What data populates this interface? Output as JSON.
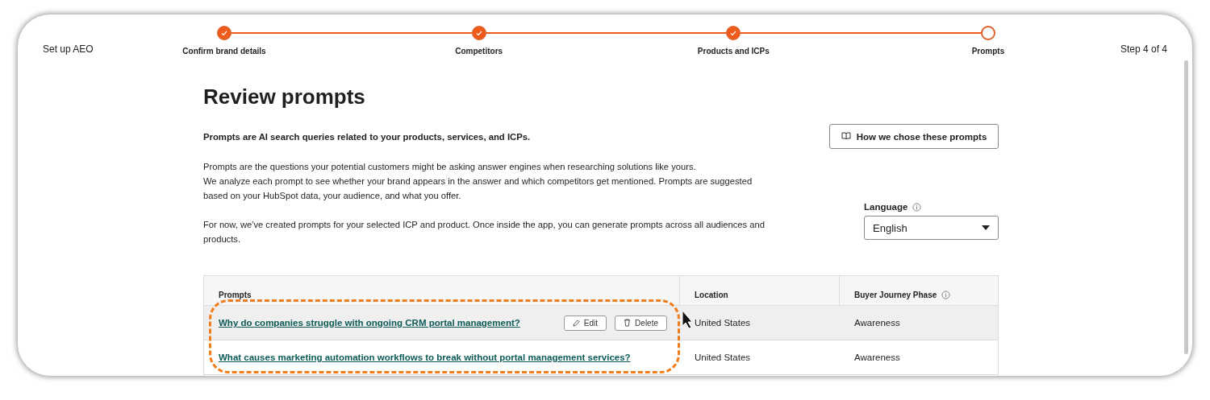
{
  "header": {
    "title": "Set up AEO",
    "step_counter": "Step 4 of 4"
  },
  "steps": [
    {
      "label": "Confirm brand details",
      "completed": true
    },
    {
      "label": "Competitors",
      "completed": true
    },
    {
      "label": "Products and ICPs",
      "completed": true
    },
    {
      "label": "Prompts",
      "completed": false
    }
  ],
  "page_title": "Review prompts",
  "intro": {
    "lead": "Prompts are AI search queries related to your products, services, and ICPs.",
    "paragraphs": [
      "Prompts are the questions your potential customers might be asking answer engines when researching solutions like yours.\nWe analyze each prompt to see whether your brand appears in the answer and which competitors get mentioned. Prompts are suggested based on your HubSpot data, your audience, and what you offer.",
      "For now, we've created prompts for your selected ICP and product. Once inside the app, you can generate prompts across all audiences and products."
    ]
  },
  "how_button": "How we chose these prompts",
  "language": {
    "label": "Language",
    "value": "English"
  },
  "table": {
    "columns": [
      "Prompts",
      "Location",
      "Buyer Journey Phase"
    ],
    "rows": [
      {
        "prompt": "Why do companies struggle with ongoing CRM portal management?",
        "location": "United States",
        "phase": "Awareness",
        "hovered": true,
        "actions": [
          "Edit",
          "Delete"
        ]
      },
      {
        "prompt": "What causes marketing automation workflows to break without portal management services?",
        "location": "United States",
        "phase": "Awareness",
        "hovered": false
      }
    ]
  }
}
